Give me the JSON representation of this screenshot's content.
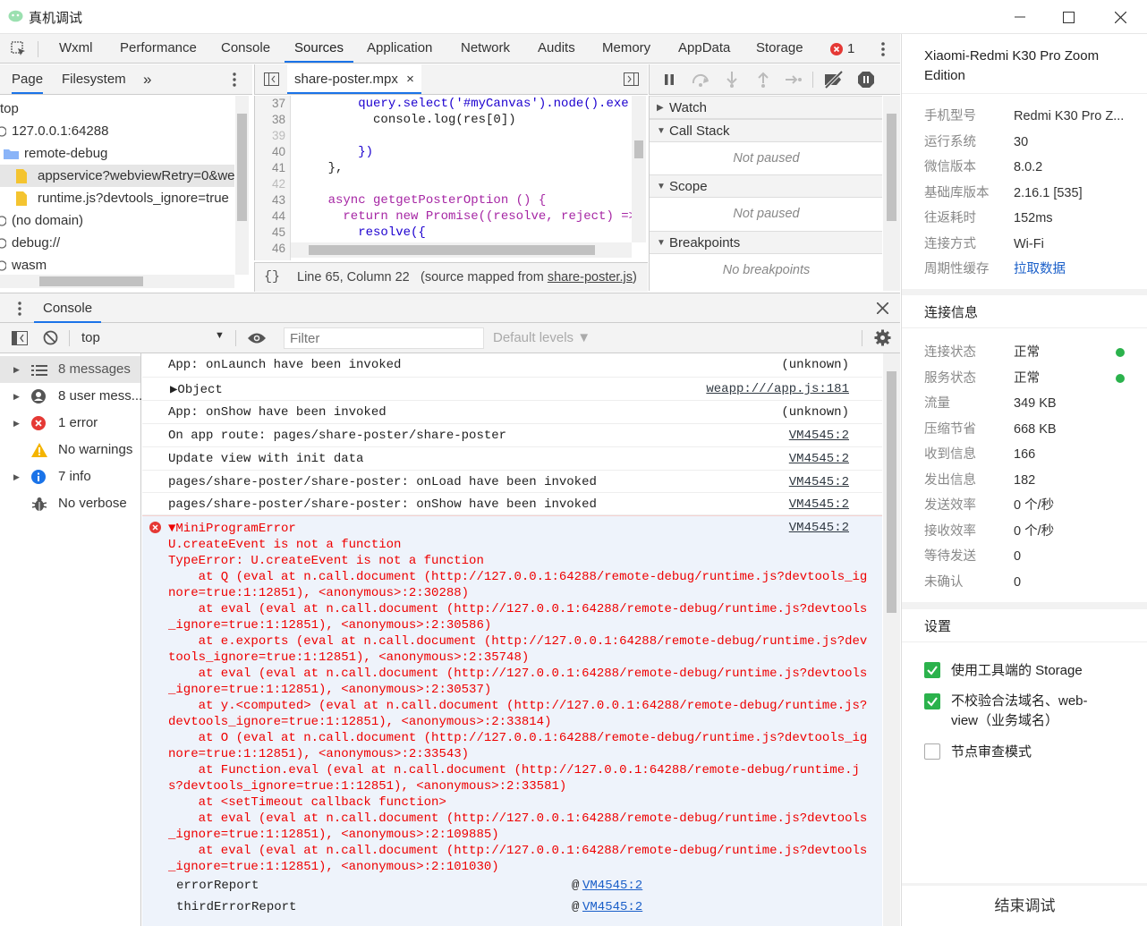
{
  "window": {
    "title": "真机调试"
  },
  "devtools_tabs": [
    "Wxml",
    "Performance",
    "Console",
    "Sources",
    "Application",
    "Network",
    "Audits",
    "Memory",
    "AppData",
    "Storage"
  ],
  "active_tab": "Sources",
  "error_count": "1",
  "navigator": {
    "tabs": [
      "Page",
      "Filesystem"
    ],
    "more": "»",
    "tree": [
      {
        "label": "top"
      },
      {
        "label": "127.0.0.1:64288"
      },
      {
        "label": "remote-debug"
      },
      {
        "label": "appservice?webviewRetry=0&we"
      },
      {
        "label": "runtime.js?devtools_ignore=true"
      },
      {
        "label": "(no domain)"
      },
      {
        "label": "debug://"
      },
      {
        "label": "wasm"
      }
    ]
  },
  "editor": {
    "file_tab": "share-poster.mpx",
    "close": "×",
    "line_numbers": [
      "37",
      "38",
      "39",
      "40",
      "41",
      "42",
      "43",
      "44",
      "45",
      "46"
    ],
    "code": [
      "        query.select('#myCanvas').node().exe",
      "          console.log(res[0])",
      "",
      "        })",
      "    },",
      "",
      "    async getgetPosterOption () {",
      "      return new Promise((resolve, reject) =>",
      "        resolve({",
      ""
    ],
    "status_braces": "{}",
    "status_position": "Line 65, Column 22",
    "status_mapped_prefix": "(source mapped from ",
    "status_mapped_file": "share-poster.js",
    "status_mapped_suffix": ")"
  },
  "debugger": {
    "sections": [
      {
        "title": "Watch",
        "body": ""
      },
      {
        "title": "Call Stack",
        "body": "Not paused"
      },
      {
        "title": "Scope",
        "body": "Not paused"
      },
      {
        "title": "Breakpoints",
        "body": "No breakpoints"
      }
    ]
  },
  "console": {
    "drawer_tab": "Console",
    "context": "top",
    "filter_placeholder": "Filter",
    "levels": "Default levels ▼",
    "sidebar": [
      {
        "label": "8 messages",
        "icon": "list-icon"
      },
      {
        "label": "8 user mess...",
        "icon": "user-icon"
      },
      {
        "label": "1 error",
        "icon": "error-icon"
      },
      {
        "label": "No warnings",
        "icon": "warning-icon"
      },
      {
        "label": "7 info",
        "icon": "info-icon"
      },
      {
        "label": "No verbose",
        "icon": "bug-icon"
      }
    ],
    "messages": [
      {
        "text": "App: onLaunch have been invoked",
        "source": "(unknown)",
        "link": false
      },
      {
        "text": "▶Object",
        "source": "weapp:///app.js:181",
        "link": true
      },
      {
        "text": "App: onShow have been invoked",
        "source": "(unknown)",
        "link": false
      },
      {
        "text": "On app route: pages/share-poster/share-poster",
        "source": "VM4545:2",
        "link": true
      },
      {
        "text": "Update view with init data",
        "source": "VM4545:2",
        "link": true
      },
      {
        "text": "pages/share-poster/share-poster: onLoad have been invoked",
        "source": "VM4545:2",
        "link": true
      },
      {
        "text": "pages/share-poster/share-poster: onShow have been invoked",
        "source": "VM4545:2",
        "link": true
      }
    ],
    "error": {
      "title": "▼MiniProgramError",
      "source": "VM4545:2",
      "lines": [
        "U.createEvent is not a function",
        "TypeError: U.createEvent is not a function",
        "    at Q (eval at n.call.document (http://127.0.0.1:64288/remote-debug/runtime.js?devtools_ig",
        "nore=true:1:12851), <anonymous>:2:30288)",
        "    at eval (eval at n.call.document (http://127.0.0.1:64288/remote-debug/runtime.js?devtools",
        "_ignore=true:1:12851), <anonymous>:2:30586)",
        "    at e.exports (eval at n.call.document (http://127.0.0.1:64288/remote-debug/runtime.js?dev",
        "tools_ignore=true:1:12851), <anonymous>:2:35748)",
        "    at eval (eval at n.call.document (http://127.0.0.1:64288/remote-debug/runtime.js?devtools",
        "_ignore=true:1:12851), <anonymous>:2:30537)",
        "    at y.<computed> (eval at n.call.document (http://127.0.0.1:64288/remote-debug/runtime.js?",
        "devtools_ignore=true:1:12851), <anonymous>:2:33814)",
        "    at O (eval at n.call.document (http://127.0.0.1:64288/remote-debug/runtime.js?devtools_ig",
        "nore=true:1:12851), <anonymous>:2:33543)",
        "    at Function.eval (eval at n.call.document (http://127.0.0.1:64288/remote-debug/runtime.j",
        "s?devtools_ignore=true:1:12851), <anonymous>:2:33581)",
        "    at <setTimeout callback function>",
        "    at eval (eval at n.call.document (http://127.0.0.1:64288/remote-debug/runtime.js?devtools",
        "_ignore=true:1:12851), <anonymous>:2:109885)",
        "    at eval (eval at n.call.document (http://127.0.0.1:64288/remote-debug/runtime.js?devtools",
        "_ignore=true:1:12851), <anonymous>:2:101030)"
      ],
      "stack_rows": [
        {
          "fn": "errorReport",
          "at": "@",
          "src": "VM4545:2"
        },
        {
          "fn": "thirdErrorReport",
          "at": "@",
          "src": "VM4545:2"
        }
      ]
    }
  },
  "device": {
    "name": "Xiaomi-Redmi K30 Pro Zoom Edition",
    "info": [
      {
        "k": "手机型号",
        "v": "Redmi K30 Pro Z..."
      },
      {
        "k": "运行系统",
        "v": "30"
      },
      {
        "k": "微信版本",
        "v": "8.0.2"
      },
      {
        "k": "基础库版本",
        "v": "2.16.1 [535]"
      },
      {
        "k": "往返耗时",
        "v": "152ms"
      },
      {
        "k": "连接方式",
        "v": "Wi-Fi"
      },
      {
        "k": "周期性缓存",
        "v": "拉取数据"
      }
    ],
    "conn_title": "连接信息",
    "conn": [
      {
        "k": "连接状态",
        "v": "正常"
      },
      {
        "k": "服务状态",
        "v": "正常"
      },
      {
        "k": "流量",
        "v": "349 KB"
      },
      {
        "k": "压缩节省",
        "v": "668 KB"
      },
      {
        "k": "收到信息",
        "v": "166"
      },
      {
        "k": "发出信息",
        "v": "182"
      },
      {
        "k": "发送效率",
        "v": "0 个/秒"
      },
      {
        "k": "接收效率",
        "v": "0 个/秒"
      },
      {
        "k": "等待发送",
        "v": "0"
      },
      {
        "k": "未确认",
        "v": "0"
      }
    ],
    "settings_title": "设置",
    "settings": [
      {
        "label": "使用工具端的 Storage",
        "checked": true
      },
      {
        "label": "不校验合法域名、web-view（业务域名）",
        "checked": true
      },
      {
        "label": "节点审查模式",
        "checked": false
      }
    ],
    "end_button": "结束调试"
  },
  "colors": {
    "accent": "#1a73e8",
    "error": "#e00000",
    "ok": "#2bb24c"
  }
}
